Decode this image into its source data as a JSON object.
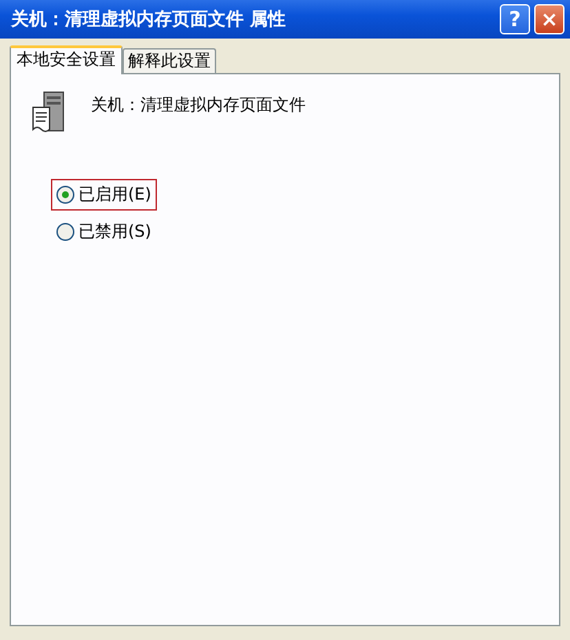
{
  "window": {
    "title": "关机：清理虚拟内存页面文件 属性",
    "buttons": [
      {
        "kind": "help",
        "label": "?"
      },
      {
        "kind": "close",
        "label": "×"
      }
    ]
  },
  "tabs": [
    {
      "label": "本地安全设置",
      "selected": true
    },
    {
      "label": "解释此设置",
      "selected": false
    }
  ],
  "policy": {
    "title": "关机：清理虚拟内存页面文件"
  },
  "options": [
    {
      "label": "已启用(E)",
      "selected": true,
      "highlighted": true
    },
    {
      "label": "已禁用(S)",
      "selected": false,
      "highlighted": false
    }
  ]
}
